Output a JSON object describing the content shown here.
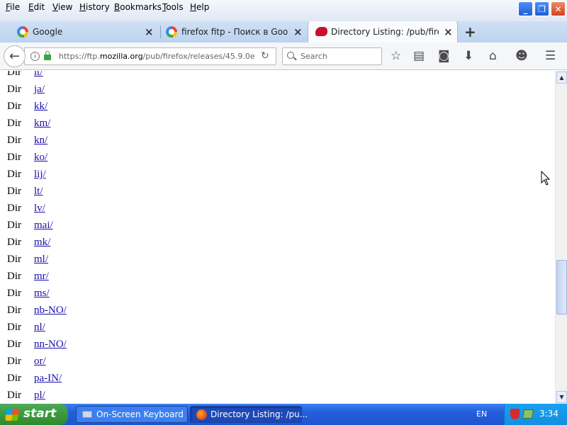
{
  "menubar": {
    "items": [
      "File",
      "Edit",
      "View",
      "History",
      "Bookmarks",
      "Tools",
      "Help"
    ]
  },
  "tabs": [
    {
      "title": "Google",
      "icon": "google-icon",
      "active": false
    },
    {
      "title": "firefox fitp - Поиск в Google",
      "icon": "google-icon",
      "active": false
    },
    {
      "title": "Directory Listing: /pub/firefox...",
      "icon": "mozilla-icon",
      "active": true
    }
  ],
  "navbar": {
    "url_prefix": "https://ftp.",
    "url_domain": "mozilla.org",
    "url_path": "/pub/firefox/releases/45.9.0e",
    "search_placeholder": "Search"
  },
  "listing": [
    {
      "type": "Dir",
      "name": "lt/"
    },
    {
      "type": "Dir",
      "name": "ja/"
    },
    {
      "type": "Dir",
      "name": "kk/"
    },
    {
      "type": "Dir",
      "name": "km/"
    },
    {
      "type": "Dir",
      "name": "kn/"
    },
    {
      "type": "Dir",
      "name": "ko/"
    },
    {
      "type": "Dir",
      "name": "lij/"
    },
    {
      "type": "Dir",
      "name": "lt/"
    },
    {
      "type": "Dir",
      "name": "lv/"
    },
    {
      "type": "Dir",
      "name": "mai/"
    },
    {
      "type": "Dir",
      "name": "mk/"
    },
    {
      "type": "Dir",
      "name": "ml/"
    },
    {
      "type": "Dir",
      "name": "mr/"
    },
    {
      "type": "Dir",
      "name": "ms/"
    },
    {
      "type": "Dir",
      "name": "nb-NO/"
    },
    {
      "type": "Dir",
      "name": "nl/"
    },
    {
      "type": "Dir",
      "name": "nn-NO/"
    },
    {
      "type": "Dir",
      "name": "or/"
    },
    {
      "type": "Dir",
      "name": "pa-IN/"
    },
    {
      "type": "Dir",
      "name": "pl/"
    }
  ],
  "taskbar": {
    "start_label": "start",
    "tasks": [
      {
        "label": "On-Screen Keyboard"
      },
      {
        "label": "Directory Listing: /pu..."
      }
    ],
    "language": "EN",
    "clock": "3:34"
  }
}
